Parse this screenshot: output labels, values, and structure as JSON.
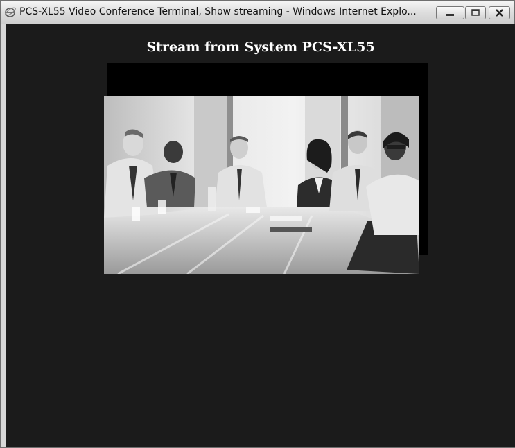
{
  "window": {
    "title": "PCS-XL55 Video Conference Terminal, Show streaming - Windows Internet Explo...",
    "icon": "ie-icon",
    "controls": [
      "minimize-icon",
      "maximize-icon",
      "close-icon"
    ]
  },
  "content": {
    "stream_title": "Stream from System PCS-XL55",
    "video": {
      "description_icon": "video-frame"
    }
  },
  "colors": {
    "background": "#1b1b1b",
    "title_text": "#ffffff",
    "titlebar": "#dcdcdc"
  }
}
